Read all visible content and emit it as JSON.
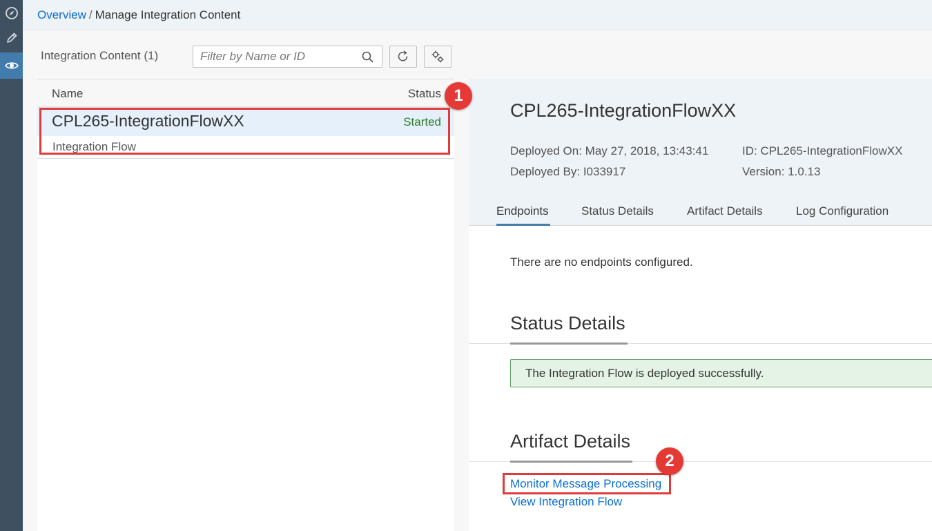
{
  "nav": {
    "items": [
      {
        "name": "discover",
        "icon": "compass-icon"
      },
      {
        "name": "design",
        "icon": "pencil-icon"
      },
      {
        "name": "monitor",
        "icon": "eye-icon",
        "active": true
      }
    ]
  },
  "breadcrumb": {
    "parent": "Overview",
    "separator": "/",
    "current": "Manage Integration Content"
  },
  "list": {
    "title": "Integration Content (1)",
    "search_placeholder": "Filter by Name or ID",
    "columns": {
      "name": "Name",
      "status": "Status"
    },
    "rows": [
      {
        "title": "CPL265-IntegrationFlowXX",
        "subtitle": "Integration Flow",
        "status": "Started"
      }
    ]
  },
  "detail": {
    "title": "CPL265-IntegrationFlowXX",
    "deployed_on": "Deployed On: May 27, 2018, 13:43:41",
    "deployed_by": "Deployed By: I033917",
    "id": "ID: CPL265-IntegrationFlowXX",
    "version": "Version: 1.0.13",
    "tabs": [
      "Endpoints",
      "Status Details",
      "Artifact Details",
      "Log Configuration"
    ],
    "active_tab": "Endpoints",
    "endpoints_message": "There are no endpoints configured.",
    "status_section_title": "Status Details",
    "status_message": "The Integration Flow is deployed successfully.",
    "artifact_section_title": "Artifact Details",
    "links": {
      "monitor": "Monitor Message Processing",
      "view_flow": "View Integration Flow"
    }
  },
  "annotations": {
    "step1": "1",
    "step2": "2"
  },
  "colors": {
    "link": "#0a6ed1",
    "status_started": "#2b7d2b",
    "annotation_red": "#e03a3a",
    "rail_bg": "#3f5161",
    "rail_active": "#427cac",
    "success_bg": "#e5f3e6"
  }
}
